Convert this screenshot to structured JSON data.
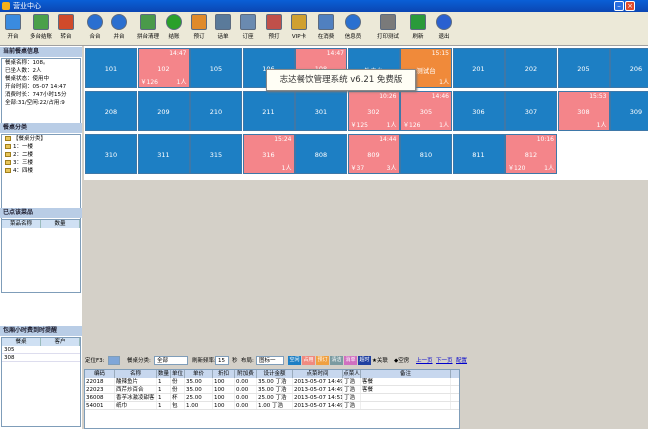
{
  "window": {
    "title": "营业中心"
  },
  "toolbar": [
    {
      "label": "开台",
      "icon": "open-table-icon",
      "color": "#3a8be0"
    },
    {
      "label": "多台结账",
      "icon": "multi-checkout-icon",
      "color": "#4aa04a"
    },
    {
      "label": "转台",
      "icon": "transfer-table-icon",
      "color": "#d04a2a"
    },
    {
      "label": "合台",
      "icon": "merge-table-icon",
      "color": "#2a6fd0"
    },
    {
      "label": "并台",
      "icon": "join-table-icon",
      "color": "#2a6fd0"
    },
    {
      "label": "拼台清理",
      "icon": "cleanup-table-icon",
      "color": "#4a9a4a"
    },
    {
      "label": "结账",
      "icon": "checkout-icon",
      "color": "#2aa02a"
    },
    {
      "label": "预订",
      "icon": "booking-icon",
      "color": "#e08a2a"
    },
    {
      "label": "话单",
      "icon": "order-slip-icon",
      "color": "#5a7a9a"
    },
    {
      "label": "订座",
      "icon": "reserve-seat-icon",
      "color": "#6a8ab0"
    },
    {
      "label": "预打",
      "icon": "preprint-icon",
      "color": "#c0504a"
    },
    {
      "label": "VIP卡",
      "icon": "vip-card-icon",
      "color": "#d0a030"
    },
    {
      "label": "在消费",
      "icon": "consuming-icon",
      "color": "#5080c0"
    },
    {
      "label": "信息员",
      "icon": "info-icon",
      "color": "#2a70d0"
    },
    {
      "label": "打印测试",
      "icon": "print-test-icon",
      "color": "#7a7a7a"
    },
    {
      "label": "刷新",
      "icon": "refresh-icon",
      "color": "#2a9a3a"
    },
    {
      "label": "退出",
      "icon": "exit-icon",
      "color": "#2a60d0"
    }
  ],
  "left": {
    "info_title": "当前餐桌信息",
    "info_lines": [
      "餐桌名称：108。",
      "已坐人数：2人",
      "餐桌状态：使用中",
      "开台时间：05-07 14:47",
      "消费时长：747小时15分",
      "全部:31/空闲:22/占用:9"
    ],
    "category_title": "餐桌分类",
    "tree_root": "【餐桌分类】",
    "tree_items": [
      "1：一楼",
      "2：二楼",
      "3：三楼",
      "4：四楼"
    ],
    "ordered_title": "已点该菜品",
    "ordered_headers": [
      "菜品名称",
      "数量"
    ],
    "hourly_title": "包厢小时费到时提醒",
    "hourly_headers": [
      "餐桌",
      "客户"
    ],
    "hourly_rows": [
      [
        "305",
        ""
      ],
      [
        "308",
        ""
      ]
    ]
  },
  "tables": [
    {
      "no": "101",
      "busy": false
    },
    {
      "no": "102",
      "busy": true,
      "time": "14:47",
      "amount": "￥126",
      "people": "1人"
    },
    {
      "no": "105",
      "busy": false
    },
    {
      "no": "106",
      "busy": false
    },
    {
      "no": "108",
      "busy": true,
      "time": "14:47",
      "amount": "",
      "people": "1人"
    },
    {
      "no": "外卖台",
      "busy": false
    },
    {
      "no": "测试台",
      "busy": "orange",
      "time": "15:15",
      "amount": "",
      "people": "1人"
    },
    {
      "no": "201",
      "busy": false
    },
    {
      "no": "202",
      "busy": false
    },
    {
      "no": "205",
      "busy": false
    },
    {
      "no": "206",
      "busy": false
    },
    {
      "no": "208",
      "busy": false
    },
    {
      "no": "209",
      "busy": false
    },
    {
      "no": "210",
      "busy": false
    },
    {
      "no": "211",
      "busy": false
    },
    {
      "no": "301",
      "busy": false
    },
    {
      "no": "302",
      "busy": true,
      "time": "10:26",
      "amount": "￥125",
      "people": "1人"
    },
    {
      "no": "305",
      "busy": true,
      "time": "14:46",
      "amount": "￥126",
      "people": "1人"
    },
    {
      "no": "306",
      "busy": false
    },
    {
      "no": "307",
      "busy": false
    },
    {
      "no": "308",
      "busy": true,
      "time": "15:53",
      "amount": "",
      "people": "1人"
    },
    {
      "no": "309",
      "busy": false
    },
    {
      "no": "310",
      "busy": false
    },
    {
      "no": "311",
      "busy": false
    },
    {
      "no": "315",
      "busy": false
    },
    {
      "no": "316",
      "busy": true,
      "time": "15:24",
      "amount": "",
      "people": "1人"
    },
    {
      "no": "808",
      "busy": false
    },
    {
      "no": "809",
      "busy": true,
      "time": "14:44",
      "amount": "￥37",
      "people": "3人"
    },
    {
      "no": "810",
      "busy": false
    },
    {
      "no": "811",
      "busy": false
    },
    {
      "no": "812",
      "busy": true,
      "time": "10:16",
      "amount": "￥120",
      "people": "1人"
    }
  ],
  "watermark": "志达餐饮管理系统 v6.21 免费版",
  "filter": {
    "hotkey_label": "定位F3:",
    "category_label": "餐桌分类:",
    "category_value": "全部",
    "refresh_label": "刷新频率:",
    "refresh_value": "15",
    "sec_label": "秒",
    "layout_label": "布局:",
    "layout_value": "图标一",
    "chips": [
      {
        "t": "空闲",
        "c": "#1d7fc4"
      },
      {
        "t": "占用",
        "c": "#f08a80"
      },
      {
        "t": "预订",
        "c": "#f0a040"
      },
      {
        "t": "清洁",
        "c": "#7a9aa0"
      },
      {
        "t": "消单",
        "c": "#d070c0"
      },
      {
        "t": "超时",
        "c": "#2040a0"
      }
    ],
    "star_label": "★关联",
    "diamond_label": "◆空房",
    "prev": "上一页",
    "next": "下一页",
    "config": "配置"
  },
  "bill": {
    "headers": [
      "编码",
      "名称",
      "数量",
      "单位",
      "单价",
      "折扣率%",
      "附加费",
      "设计金额",
      "点菜时间",
      "点菜人",
      "备注"
    ],
    "rows": [
      [
        "22018",
        "酸辣鱼片",
        "1",
        "份",
        "35.00",
        "100",
        "0.00",
        "35.00 丁浩",
        "2013-05-07 14:49",
        "丁浩",
        "客餐"
      ],
      [
        "22023",
        "西芹炒百合",
        "1",
        "份",
        "35.00",
        "100",
        "0.00",
        "35.00 丁浩",
        "2013-05-07 14:49",
        "丁浩",
        "客餐"
      ],
      [
        "36008",
        "香芋冰激凌甜客",
        "1",
        "杯",
        "25.00",
        "100",
        "0.00",
        "25.00 丁浩",
        "2013-05-07 14:51",
        "丁浩",
        ""
      ],
      [
        "54001",
        "纸巾",
        "1",
        "包",
        "1.00",
        "100",
        "0.00",
        "1.00 丁浩",
        "2013-05-07 14:49",
        "丁浩",
        ""
      ]
    ]
  }
}
